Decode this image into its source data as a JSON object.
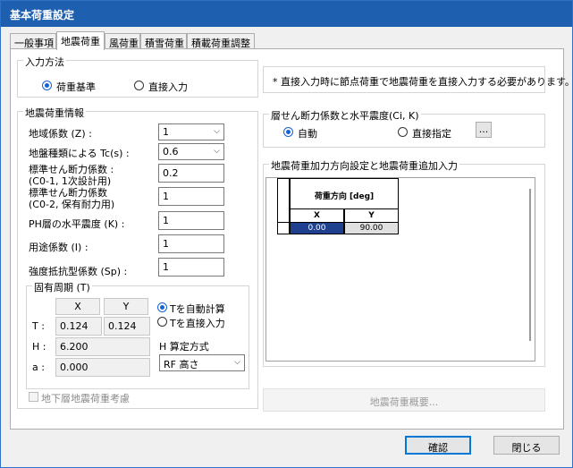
{
  "window": {
    "title": "基本荷重設定"
  },
  "tabs": [
    "一般事項",
    "地震荷重",
    "風荷重",
    "積雪荷重",
    "積載荷重調整"
  ],
  "input_method": {
    "label": "入力方法",
    "option1": "荷重基準",
    "option2": "直接入力",
    "selected": "荷重基準"
  },
  "note": "* 直接入力時に節点荷重で地震荷重を直接入力する必要があります。",
  "seismic_info": {
    "label": "地震荷重情報",
    "region_coef_label": "地域係数 (Z) :",
    "region_coef_value": "1",
    "ground_type_label": "地盤種類による Tc(s) :",
    "ground_type_value": "0.6",
    "shear_coef1_label1": "標準せん断力係数 :",
    "shear_coef1_label2": "(C0-1, 1次設計用)",
    "shear_coef1_value": "0.2",
    "shear_coef2_label1": "標準せん断力係数",
    "shear_coef2_label2": "(C0-2, 保有耐力用)",
    "shear_coef2_value": "1",
    "ph_label": "PH層の水平震度 (K) :",
    "ph_value": "1",
    "use_coef_label": "用途係数 (I) :",
    "use_coef_value": "1",
    "strength_label": "強度抵抗型係数 (Sp) :",
    "strength_value": "1"
  },
  "period": {
    "label": "固有周期 (T)",
    "col_x": "X",
    "col_y": "Y",
    "t_label": "T :",
    "t_x": "0.124",
    "t_y": "0.124",
    "h_label": "H :",
    "h_value": "6.200",
    "a_label": "a :",
    "a_value": "0.000",
    "auto_calc": "Tを自動計算",
    "direct_input": "Tを直接入力",
    "selected": "Tを自動計算",
    "h_method_label": "H 算定方式",
    "h_method_value": "RF 高さ"
  },
  "basement": {
    "label": "地下層地震荷重考慮",
    "checked": false
  },
  "layer_shear": {
    "label": "層せん断力係数と水平震度(Ci, K)",
    "auto": "自動",
    "direct": "直接指定",
    "selected": "自動",
    "more": "..."
  },
  "direction": {
    "label": "地震荷重加力方向設定と地震荷重追加入力",
    "header": "荷重方向 [deg]",
    "col_x": "X",
    "col_y": "Y",
    "rows": [
      {
        "x": "0.00",
        "y": "90.00"
      }
    ]
  },
  "overview_button": "地震荷重概要...",
  "ok_button": "確認",
  "close_button": "閉じる"
}
